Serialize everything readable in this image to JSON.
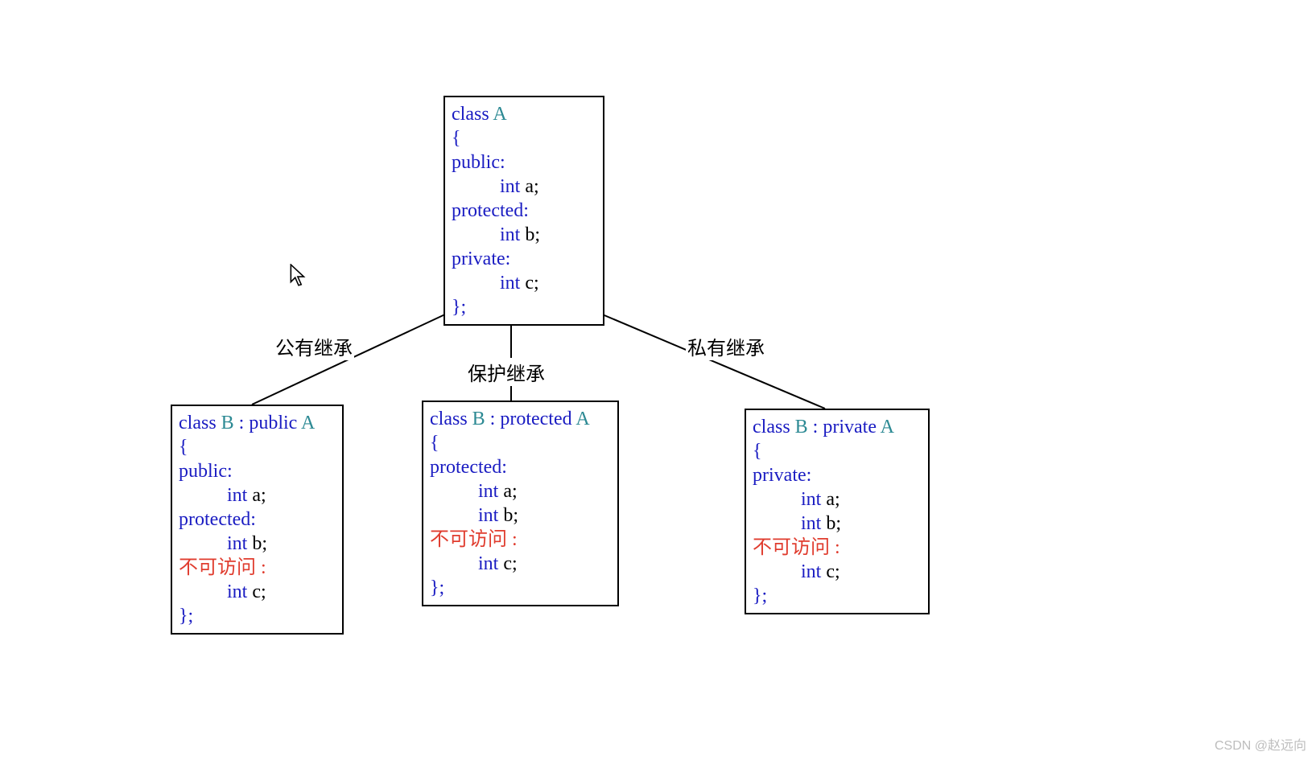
{
  "parent": {
    "classKw": "class",
    "name": "A",
    "open": "{",
    "sections": [
      {
        "access": "public:",
        "member_type": "int",
        "member_name": "a;"
      },
      {
        "access": "protected:",
        "member_type": "int",
        "member_name": "b;"
      },
      {
        "access": "private:",
        "member_type": "int",
        "member_name": "c;"
      }
    ],
    "close": "};"
  },
  "edges": {
    "public": "公有继承",
    "protected": "保护继承",
    "private": "私有继承"
  },
  "childPublic": {
    "decl": {
      "classKw": "class",
      "name": "B",
      "sep": " : ",
      "modKw": "public",
      "base": "A"
    },
    "open": "{",
    "sections": [
      {
        "access": "public:",
        "member_type": "int",
        "member_name": "a;"
      },
      {
        "access": "protected:",
        "member_type": "int",
        "member_name": "b;"
      }
    ],
    "noaccessLabel": "不可访问 :",
    "noaccessMember": {
      "type": "int",
      "name": "c;"
    },
    "close": "};"
  },
  "childProtected": {
    "decl": {
      "classKw": "class",
      "name": "B",
      "sep": " : ",
      "modKw": "protected",
      "base": "A"
    },
    "open": "{",
    "access": "protected:",
    "members": [
      {
        "type": "int",
        "name": "a;"
      },
      {
        "type": "int",
        "name": "b;"
      }
    ],
    "noaccessLabel": "不可访问 :",
    "noaccessMember": {
      "type": "int",
      "name": "c;"
    },
    "close": "};"
  },
  "childPrivate": {
    "decl": {
      "classKw": "class",
      "name": "B",
      "sep": " :",
      "modKw": "private",
      "postSpace": "  ",
      "base": "A"
    },
    "open": "{",
    "access": "private:",
    "members": [
      {
        "type": "int",
        "name": "a;"
      },
      {
        "type": "int",
        "name": "b;"
      }
    ],
    "noaccessLabel": "不可访问 :",
    "noaccessMember": {
      "type": "int",
      "name": "c;"
    },
    "close": "};"
  },
  "watermark": "CSDN @赵远向"
}
